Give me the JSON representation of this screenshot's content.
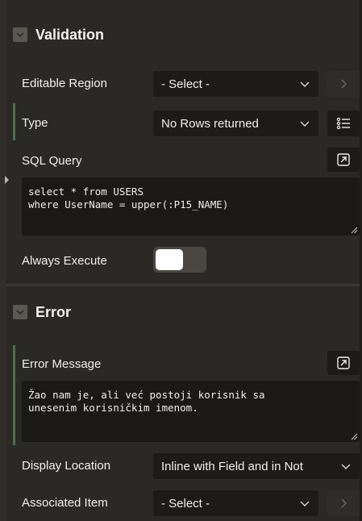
{
  "validation": {
    "title": "Validation",
    "editable_region": {
      "label": "Editable Region",
      "value": "- Select -"
    },
    "type": {
      "label": "Type",
      "value": "No Rows returned"
    },
    "sql_query": {
      "label": "SQL Query",
      "line1": "select * from USERS",
      "line2": "where UserName = upper(:P15_NAME)"
    },
    "always_execute": {
      "label": "Always Execute",
      "on": false
    }
  },
  "error": {
    "title": "Error",
    "message": {
      "label": "Error Message",
      "line1": "Žao nam je, ali već postoji korisnik sa",
      "line2": "unesenim korisničkim imenom."
    },
    "display_location": {
      "label": "Display Location",
      "value": "Inline with Field and in Not"
    },
    "associated_item": {
      "label": "Associated Item",
      "value": "- Select -"
    }
  },
  "colors": {
    "background": "#2b2926",
    "field": "#1c1b19",
    "accent": "#47744a"
  }
}
